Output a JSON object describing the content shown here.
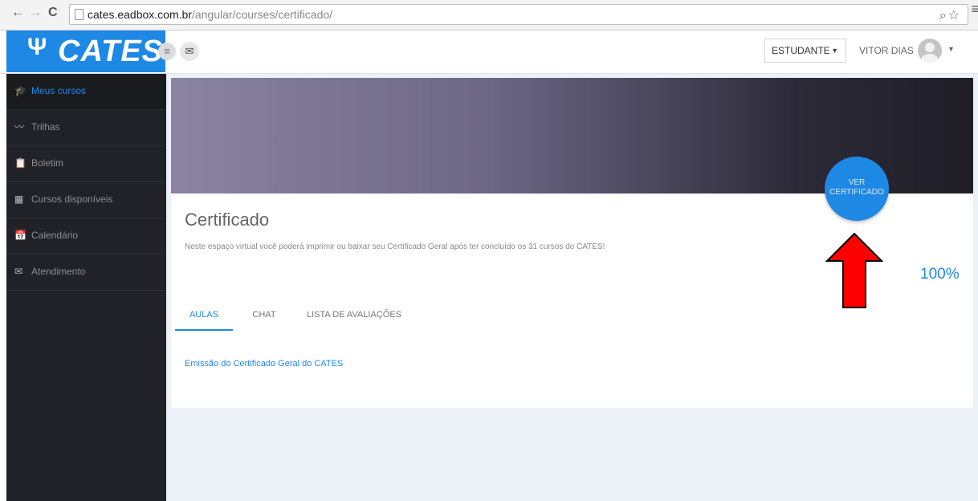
{
  "browser": {
    "back_icon": "←",
    "forward_icon": "→",
    "reload_icon": "C",
    "url_domain": "cates.eadbox.com.br",
    "url_path": "/angular/courses/certificado/",
    "zoom_icon": "⌕",
    "star_icon": "☆",
    "menu_icon": "≡"
  },
  "header": {
    "logo_symbol": "Ψ",
    "logo_text": "CATES",
    "hamburger_icon": "≡",
    "mail_icon": "✉",
    "role_label": "ESTUDANTE",
    "role_caret": "▼",
    "user_name": "VITOR DIAS",
    "user_caret": "▼"
  },
  "sidebar": {
    "items": [
      {
        "icon": "🎓",
        "label": "Meus cursos"
      },
      {
        "icon": "〰",
        "label": "Trilhas"
      },
      {
        "icon": "📋",
        "label": "Boletim"
      },
      {
        "icon": "▦",
        "label": "Cursos disponíveis"
      },
      {
        "icon": "📅",
        "label": "Calendário"
      },
      {
        "icon": "✉",
        "label": "Atendimento"
      }
    ]
  },
  "main": {
    "cert_button_label": "VER CERTIFICADO",
    "title": "Certificado",
    "description": "Neste espaço virtual você poderá imprimir ou baixar seu Certificado Geral após ter concluído os 31 cursos do CATES!",
    "progress": "100%",
    "tabs": [
      {
        "label": "AULAS",
        "active": true
      },
      {
        "label": "CHAT",
        "active": false
      },
      {
        "label": "LISTA DE AVALIAÇÕES",
        "active": false
      }
    ],
    "lesson_link": "Emissão do Certificado Geral do CATES"
  },
  "colors": {
    "accent": "#1e88e5",
    "sidebar_bg": "#212227",
    "arrow": "#ff0000"
  }
}
